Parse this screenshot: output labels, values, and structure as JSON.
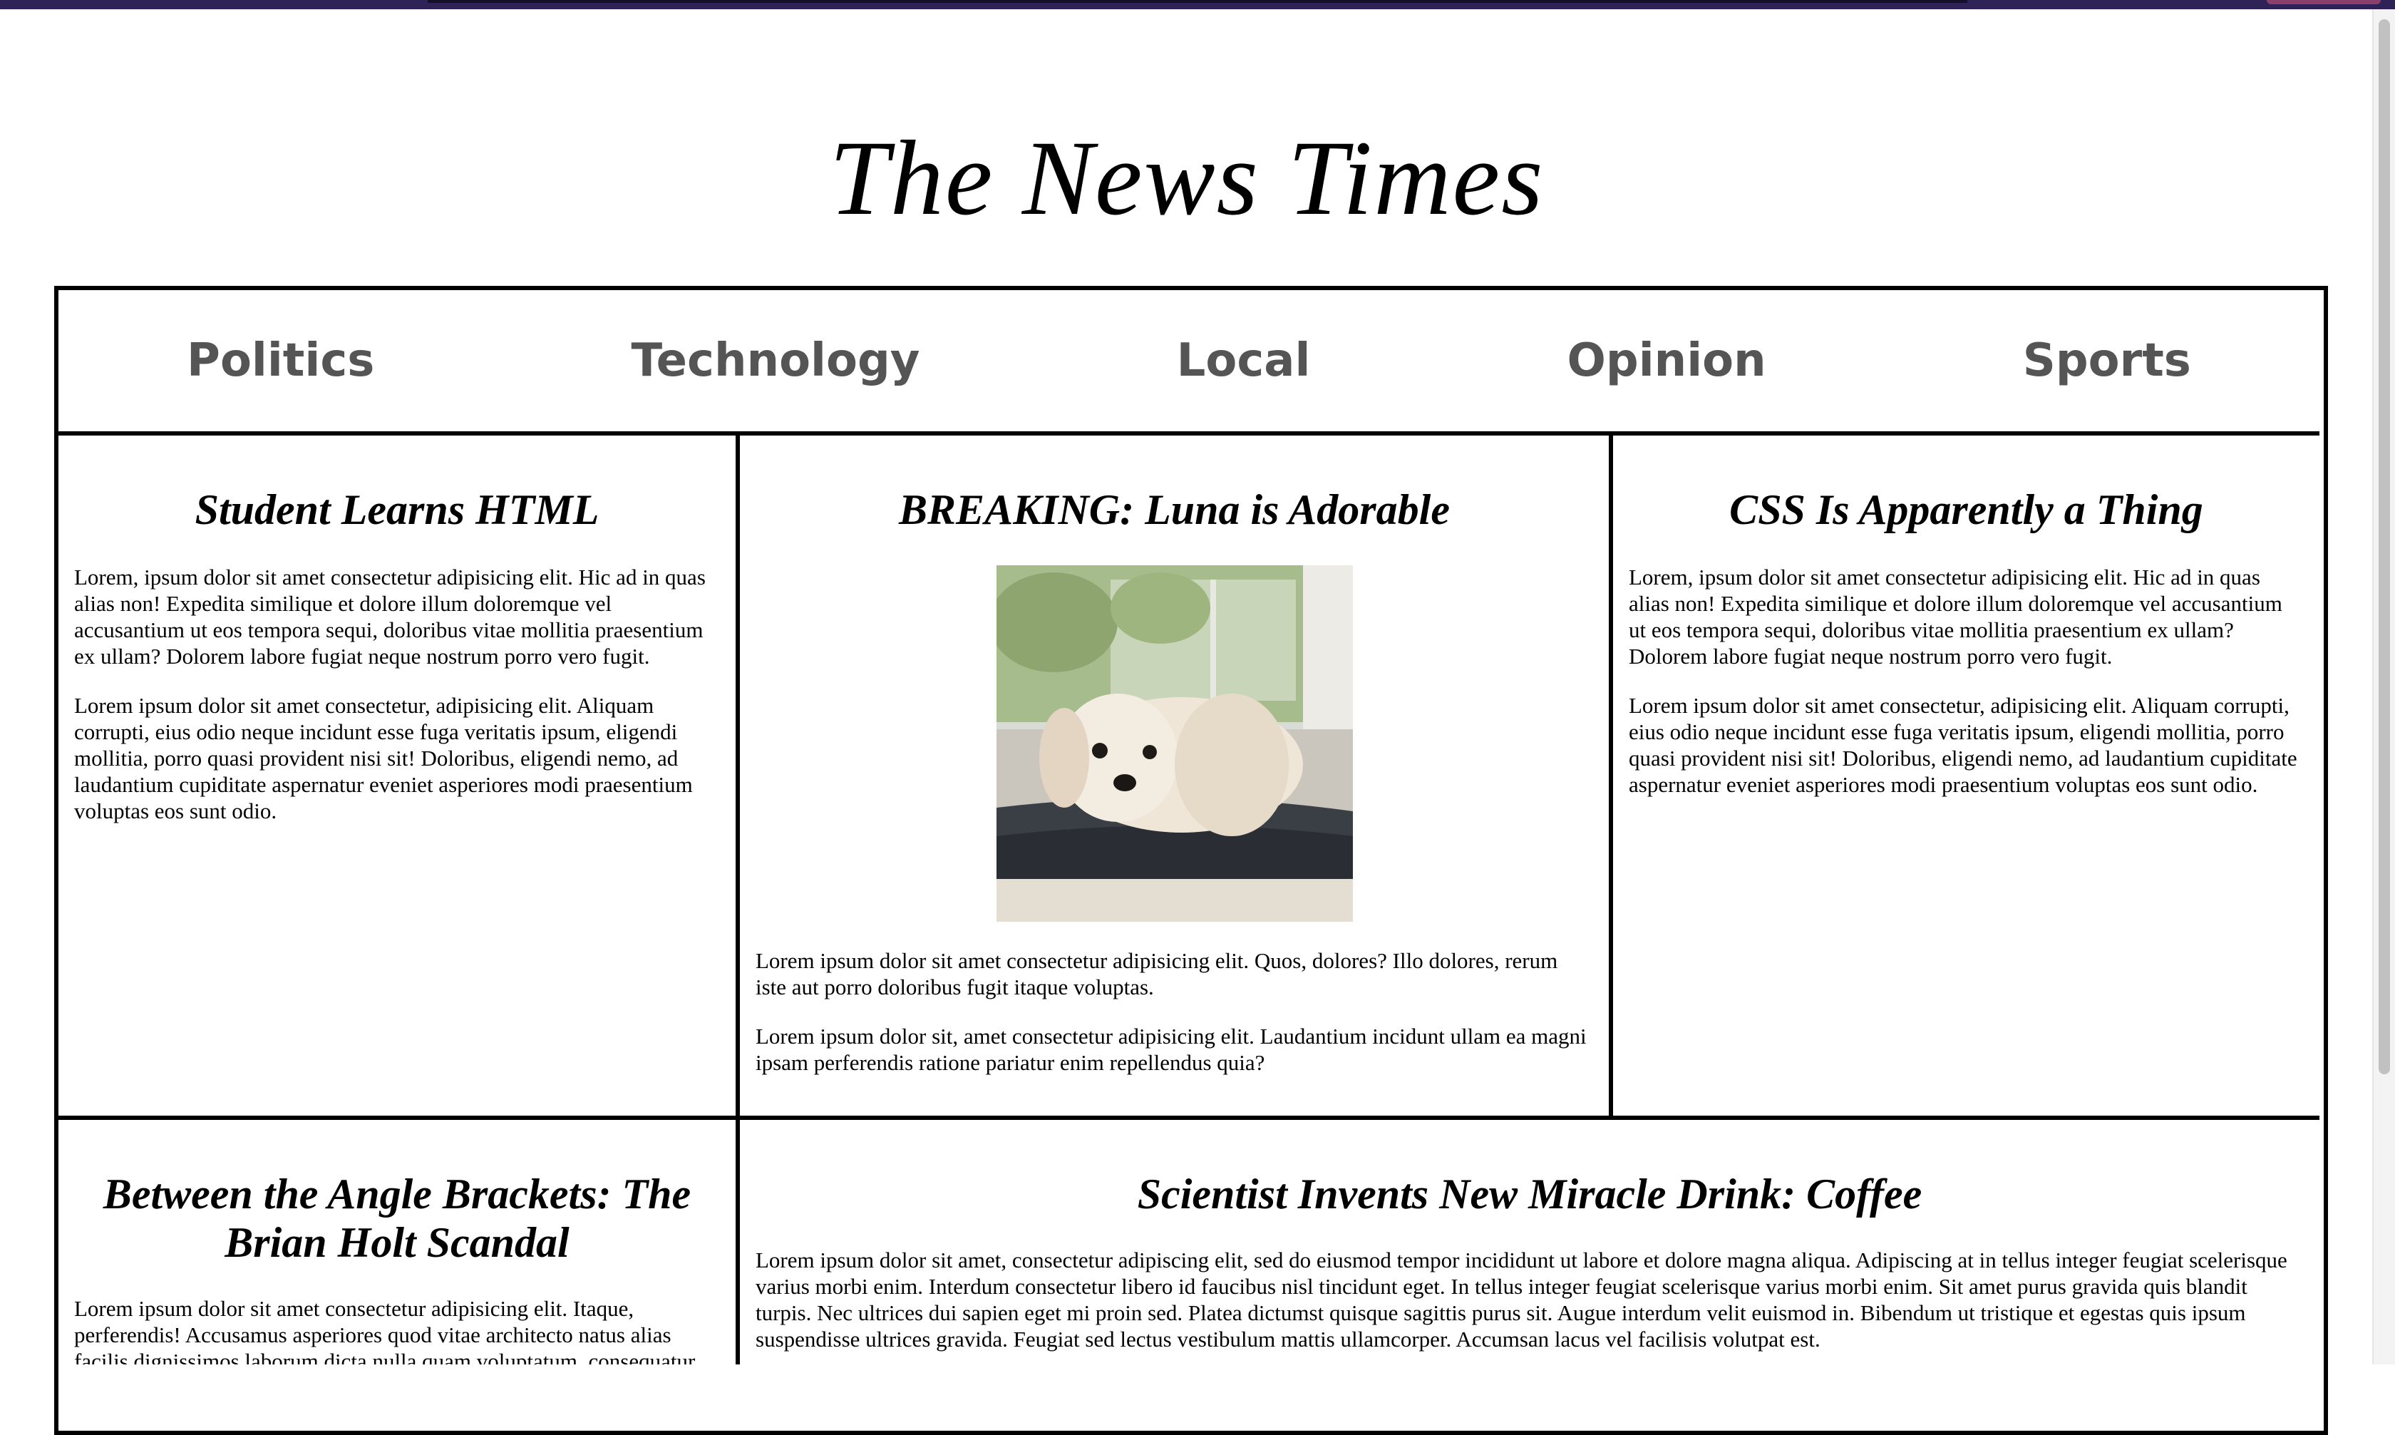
{
  "site": {
    "title": "The News Times"
  },
  "nav": {
    "items": [
      "Politics",
      "Technology",
      "Local",
      "Opinion",
      "Sports"
    ]
  },
  "articles": {
    "a1": {
      "headline": "Student Learns HTML",
      "p1": "Lorem, ipsum dolor sit amet consectetur adipisicing elit. Hic ad in quas alias non! Expedita similique et dolore illum doloremque vel accusantium ut eos tempora sequi, doloribus vitae mollitia praesentium ex ullam? Dolorem labore fugiat neque nostrum porro vero fugit.",
      "p2": "Lorem ipsum dolor sit amet consectetur, adipisicing elit. Aliquam corrupti, eius odio neque incidunt esse fuga veritatis ipsum, eligendi mollitia, porro quasi provident nisi sit! Doloribus, eligendi nemo, ad laudantium cupiditate aspernatur eveniet asperiores modi praesentium voluptas eos sunt odio."
    },
    "a2": {
      "headline": "BREAKING: Luna is Adorable",
      "p1": "Lorem ipsum dolor sit amet consectetur adipisicing elit. Quos, dolores? Illo dolores, rerum iste aut porro doloribus fugit itaque voluptas.",
      "p2": "Lorem ipsum dolor sit, amet consectetur adipisicing elit. Laudantium incidunt ullam ea magni ipsam perferendis ratione pariatur enim repellendus quia?"
    },
    "a3": {
      "headline": "CSS Is Apparently a Thing",
      "p1": "Lorem, ipsum dolor sit amet consectetur adipisicing elit. Hic ad in quas alias non! Expedita similique et dolore illum doloremque vel accusantium ut eos tempora sequi, doloribus vitae mollitia praesentium ex ullam? Dolorem labore fugiat neque nostrum porro vero fugit.",
      "p2": "Lorem ipsum dolor sit amet consectetur, adipisicing elit. Aliquam corrupti, eius odio neque incidunt esse fuga veritatis ipsum, eligendi mollitia, porro quasi provident nisi sit! Doloribus, eligendi nemo, ad laudantium cupiditate aspernatur eveniet asperiores modi praesentium voluptas eos sunt odio."
    },
    "a4": {
      "headline": "Between the Angle Brackets: The Brian Holt Scandal",
      "p1": "Lorem ipsum dolor sit amet consectetur adipisicing elit. Itaque, perferendis! Accusamus asperiores quod vitae architecto natus alias facilis dignissimos laborum dicta nulla quam voluptatum, consequatur nihil iusto."
    },
    "a5": {
      "headline": "Scientist Invents New Miracle Drink: Coffee",
      "p1": "Lorem ipsum dolor sit amet, consectetur adipiscing elit, sed do eiusmod tempor incididunt ut labore et dolore magna aliqua. Adipiscing at in tellus integer feugiat scelerisque varius morbi enim. Interdum consectetur libero id faucibus nisl tincidunt eget. In tellus integer feugiat scelerisque varius morbi enim. Sit amet purus gravida quis blandit turpis. Nec ultrices dui sapien eget mi proin sed. Platea dictumst quisque sagittis purus sit. Augue interdum velit euismod in. Bibendum ut tristique et egestas quis ipsum suspendisse ultrices gravida. Feugiat sed lectus vestibulum mattis ullamcorper. Accumsan lacus vel facilisis volutpat est."
    }
  }
}
